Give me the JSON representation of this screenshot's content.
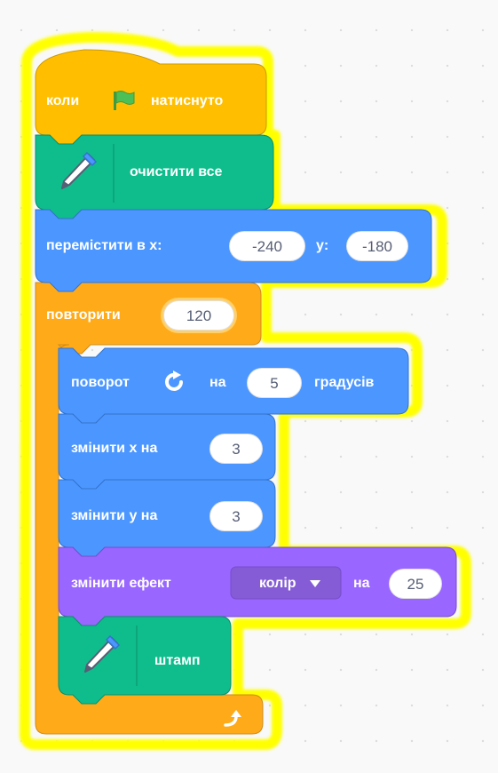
{
  "colors": {
    "events": "#ffbf00",
    "pen": "#0fbd8c",
    "motion": "#4c97ff",
    "control": "#ffab19",
    "looks": "#9966ff",
    "highlight": "#ffff00"
  },
  "script": {
    "hat": {
      "label_start": "коли",
      "flag_icon": "green-flag-icon",
      "label_end": "натиснуто"
    },
    "clear": {
      "icon": "pen-icon",
      "label": "очистити все"
    },
    "goto": {
      "label": "перемістити в x:",
      "x_value": "-240",
      "y_label": "y:",
      "y_value": "-180"
    },
    "repeat": {
      "label": "повторити",
      "count": "120",
      "loop_icon": "loop-arrow-icon"
    },
    "turn": {
      "label": "поворот",
      "icon": "rotate-right-icon",
      "on_label": "на",
      "value": "5",
      "degrees_label": "градусів"
    },
    "change_x": {
      "label": "змінити х на",
      "value": "3"
    },
    "change_y": {
      "label": "змінити y на",
      "value": "3"
    },
    "change_effect": {
      "label": "змінити ефект",
      "effect_value": "колір",
      "dropdown_icon": "dropdown-arrow-icon",
      "on_label": "на",
      "value": "25"
    },
    "stamp": {
      "icon": "pen-icon",
      "label": "штамп"
    }
  }
}
